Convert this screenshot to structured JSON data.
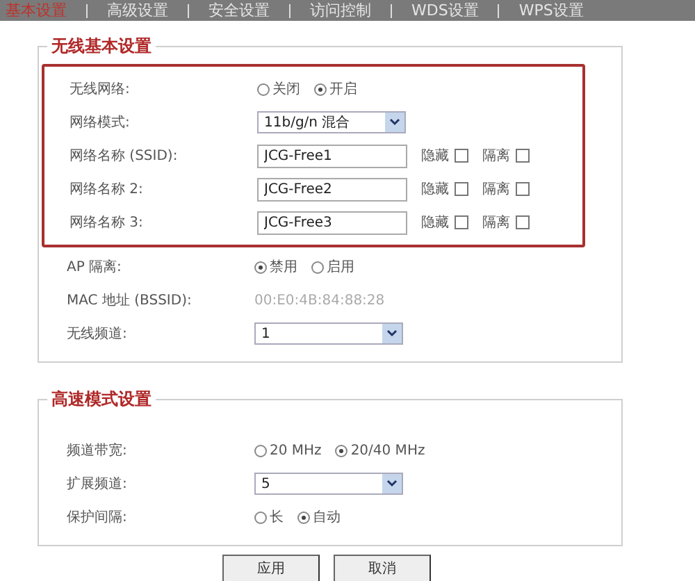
{
  "nav": [
    {
      "label": "基本设置",
      "selected": true
    },
    {
      "label": "高级设置",
      "selected": false
    },
    {
      "label": "安全设置",
      "selected": false
    },
    {
      "label": "访问控制",
      "selected": false
    },
    {
      "label": "WDS设置",
      "selected": false
    },
    {
      "label": "WPS设置",
      "selected": false
    }
  ],
  "basic": {
    "title": "无线基本设置",
    "highlighted": [
      {
        "kind": "radio",
        "label": "无线网络:",
        "options": [
          {
            "label": "关闭",
            "selected": false
          },
          {
            "label": "开启",
            "selected": true
          }
        ]
      },
      {
        "kind": "select",
        "label": "网络模式:",
        "value": "11b/g/n 混合"
      },
      {
        "kind": "ssid",
        "label": "网络名称 (SSID):",
        "value": "JCG-Free1",
        "hide": {
          "label": "隐藏",
          "checked": false
        },
        "isolate": {
          "label": "隔离",
          "checked": false
        }
      },
      {
        "kind": "ssid",
        "label": "网络名称 2:",
        "value": "JCG-Free2",
        "hide": {
          "label": "隐藏",
          "checked": false
        },
        "isolate": {
          "label": "隔离",
          "checked": false
        }
      },
      {
        "kind": "ssid",
        "label": "网络名称 3:",
        "value": "JCG-Free3",
        "hide": {
          "label": "隐藏",
          "checked": false
        },
        "isolate": {
          "label": "隔离",
          "checked": false
        }
      }
    ],
    "rows": [
      {
        "kind": "radio",
        "label": "AP 隔离:",
        "options": [
          {
            "label": "禁用",
            "selected": true
          },
          {
            "label": "启用",
            "selected": false
          }
        ]
      },
      {
        "kind": "text",
        "label": "MAC 地址 (BSSID):",
        "value": "00:E0:4B:84:88:28"
      },
      {
        "kind": "select",
        "label": "无线频道:",
        "value": "1"
      }
    ]
  },
  "advanced": {
    "title": "高速模式设置",
    "rows": [
      {
        "kind": "radio",
        "label": "频道带宽:",
        "options": [
          {
            "label": "20 MHz",
            "selected": false
          },
          {
            "label": "20/40 MHz",
            "selected": true
          }
        ]
      },
      {
        "kind": "select",
        "label": "扩展频道:",
        "value": "5"
      },
      {
        "kind": "radio",
        "label": "保护间隔:",
        "options": [
          {
            "label": "长",
            "selected": false
          },
          {
            "label": "自动",
            "selected": true
          }
        ]
      }
    ]
  },
  "buttons": [
    "应用",
    "取消"
  ]
}
